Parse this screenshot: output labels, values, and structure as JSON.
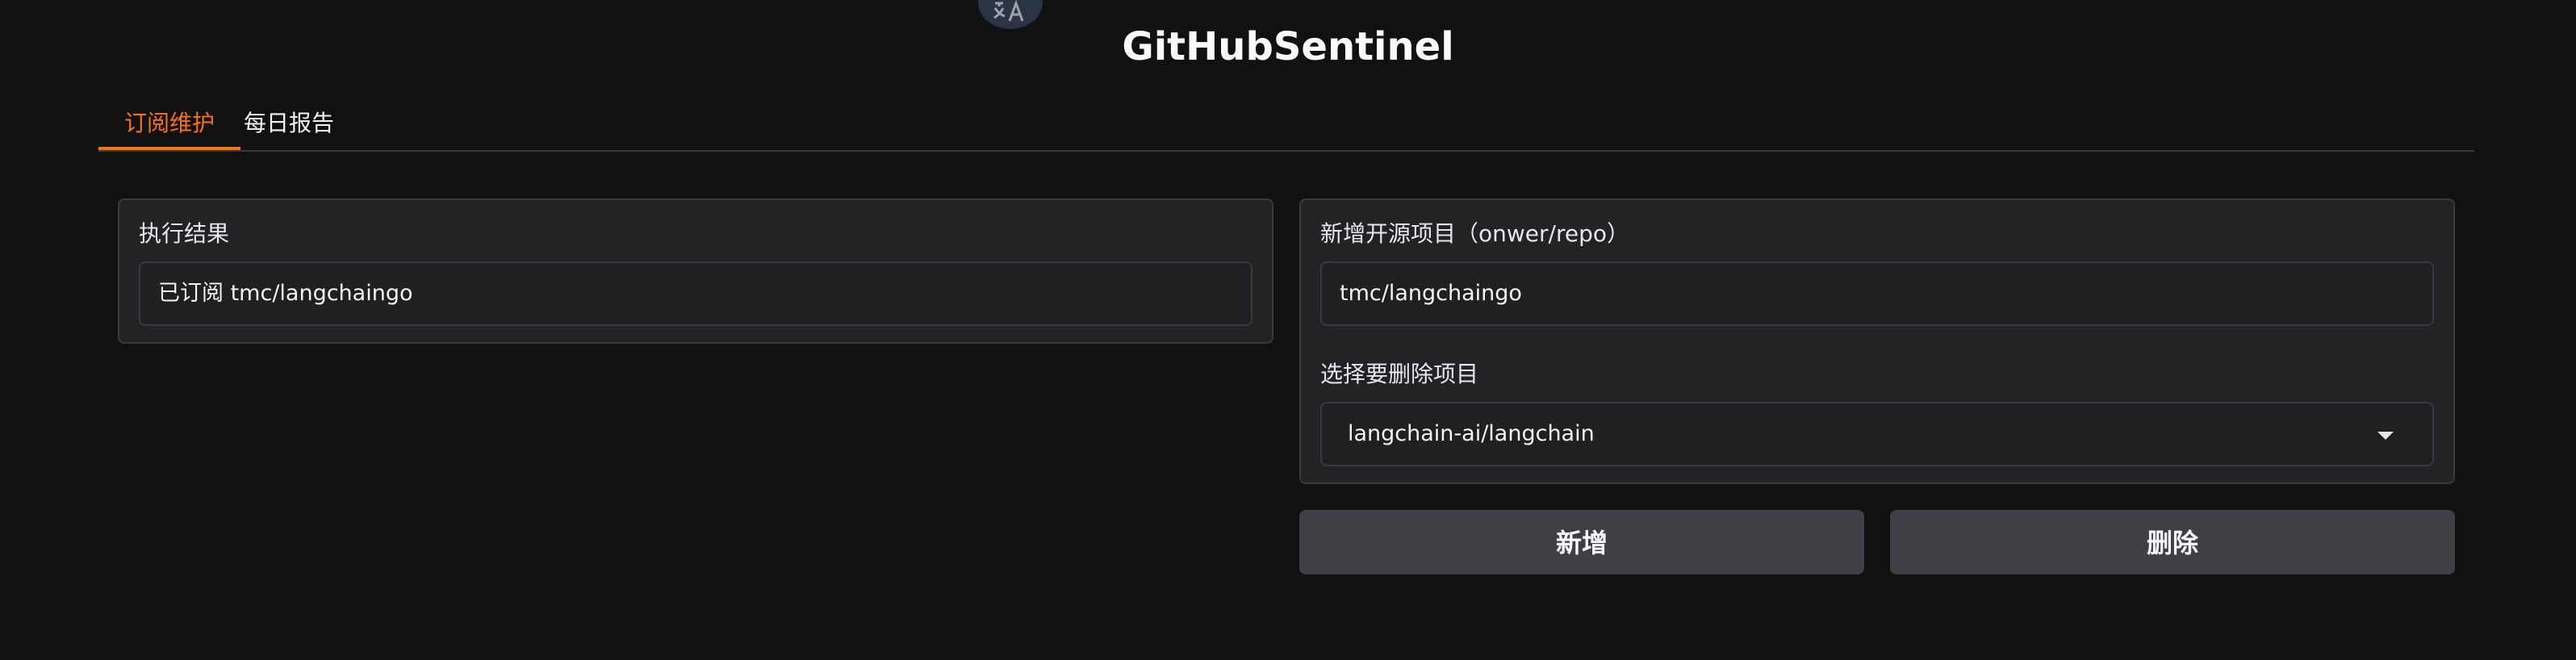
{
  "app": {
    "title": "GitHubSentinel"
  },
  "tabs": [
    {
      "label": "订阅维护",
      "active": true
    },
    {
      "label": "每日报告",
      "active": false
    }
  ],
  "result_panel": {
    "label": "执行结果",
    "value": "已订阅 tmc/langchaingo"
  },
  "form_panel": {
    "add_label": "新增开源项目（onwer/repo）",
    "add_value": "tmc/langchaingo",
    "delete_label": "选择要删除项目",
    "delete_selected": "langchain-ai/langchain"
  },
  "buttons": {
    "add": "新增",
    "delete": "删除"
  },
  "icons": {
    "translate": "translate-icon",
    "dropdown": "chevron-down-icon"
  },
  "colors": {
    "accent": "#f97316",
    "background": "#111112",
    "panel": "#232326",
    "button": "#3f3f46"
  }
}
